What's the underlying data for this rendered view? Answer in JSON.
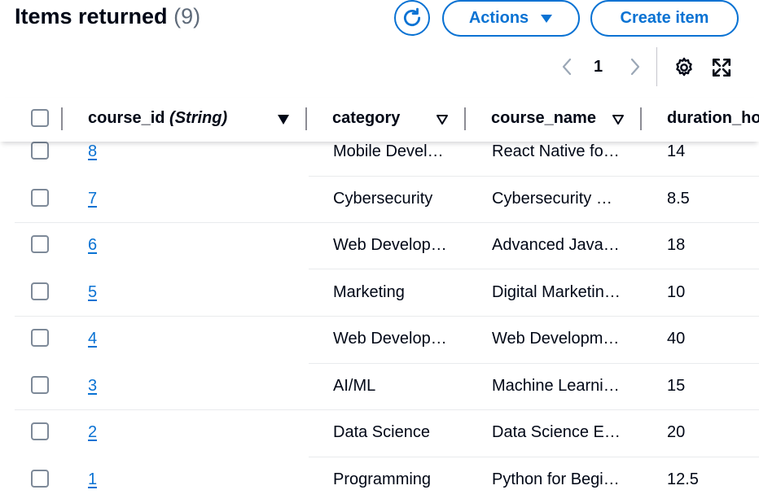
{
  "header": {
    "title": "Items returned",
    "count": "(9)",
    "actions_label": "Actions",
    "create_label": "Create item"
  },
  "pagination": {
    "current_page": "1"
  },
  "table": {
    "columns": [
      {
        "key": "course_id",
        "label": "course_id",
        "type": "(String)"
      },
      {
        "key": "category",
        "label": "category"
      },
      {
        "key": "course_name",
        "label": "course_name"
      },
      {
        "key": "duration",
        "label": "duration_ho"
      }
    ],
    "rows": [
      {
        "course_id": "8",
        "category": "Mobile Development",
        "course_name": "React Native for Beginners",
        "duration": "14"
      },
      {
        "course_id": "7",
        "category": "Cybersecurity",
        "course_name": "Cybersecurity Fundamentals",
        "duration": "8.5"
      },
      {
        "course_id": "6",
        "category": "Web Development",
        "course_name": "Advanced JavaScript",
        "duration": "18"
      },
      {
        "course_id": "5",
        "category": "Marketing",
        "course_name": "Digital Marketing Basics",
        "duration": "10"
      },
      {
        "course_id": "4",
        "category": "Web Development",
        "course_name": "Web Development Bootcamp",
        "duration": "40"
      },
      {
        "course_id": "3",
        "category": "AI/ML",
        "course_name": "Machine Learning Basics",
        "duration": "15"
      },
      {
        "course_id": "2",
        "category": "Data Science",
        "course_name": "Data Science Essentials",
        "duration": "20"
      },
      {
        "course_id": "1",
        "category": "Programming",
        "course_name": "Python for Beginners",
        "duration": "12.5"
      }
    ]
  },
  "colors": {
    "accent": "#0972d3",
    "text": "#000716",
    "muted": "#5f6b7a",
    "border": "#7d8998"
  }
}
